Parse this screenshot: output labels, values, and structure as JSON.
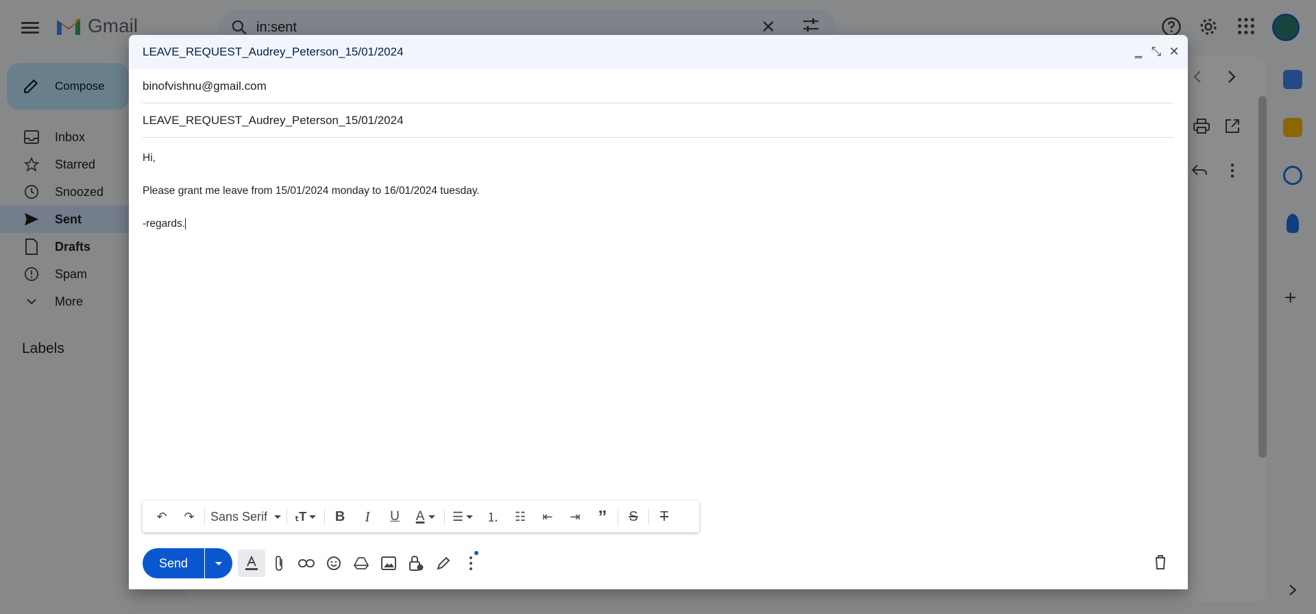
{
  "app": {
    "name": "Gmail"
  },
  "search": {
    "query": "in:sent"
  },
  "compose_button": {
    "label": "Compose"
  },
  "sidebar": {
    "items": [
      {
        "label": "Inbox",
        "icon": "inbox-icon"
      },
      {
        "label": "Starred",
        "icon": "star-icon"
      },
      {
        "label": "Snoozed",
        "icon": "clock-icon"
      },
      {
        "label": "Sent",
        "icon": "send-icon",
        "active": true
      },
      {
        "label": "Drafts",
        "icon": "draft-icon"
      },
      {
        "label": "Spam",
        "icon": "spam-icon"
      },
      {
        "label": "More",
        "icon": "chevron-down-icon"
      }
    ],
    "labels_title": "Labels"
  },
  "compose": {
    "title": "LEAVE_REQUEST_Audrey_Peterson_15/01/2024",
    "to": "binofvishnu@gmail.com",
    "subject": "LEAVE_REQUEST_Audrey_Peterson_15/01/2024",
    "body": {
      "line1": "Hi,",
      "line2": "Please grant me leave from 15/01/2024 monday to 16/01/2024 tuesday.",
      "line3": "-regards."
    },
    "toolbar": {
      "font": "Sans Serif"
    },
    "send_label": "Send"
  },
  "colors": {
    "accent": "#0b57d0",
    "compose_bg": "#c2e7ff",
    "active_nav": "#d3e3fd"
  }
}
